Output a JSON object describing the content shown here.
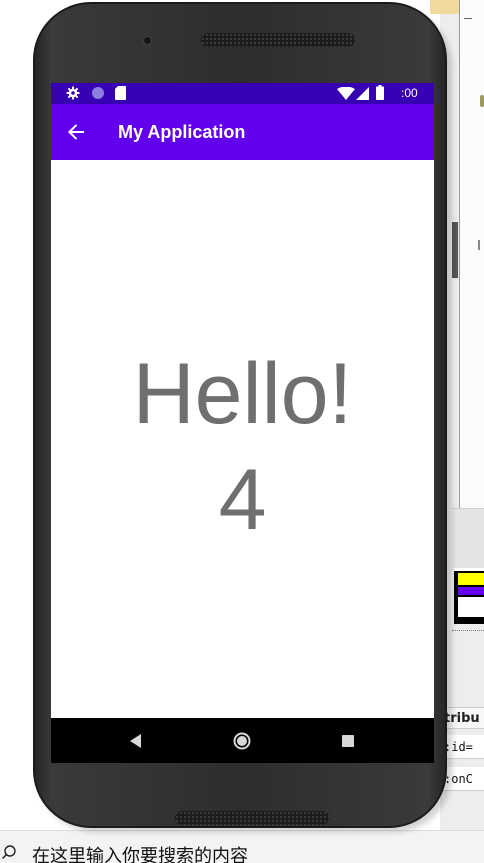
{
  "emulator": {
    "status_bar": {
      "time": ":00",
      "icons": [
        "gear-icon",
        "circle-icon",
        "sdcard-icon",
        "wifi-icon",
        "signal-icon",
        "battery-icon"
      ]
    },
    "app_bar": {
      "title": "My Application",
      "navigation_icon": "back-arrow-icon"
    },
    "content": {
      "greeting": "Hello!",
      "count": "4"
    },
    "nav_bar": {
      "buttons": [
        "nav-back-icon",
        "nav-home-icon",
        "nav-recents-icon"
      ]
    }
  },
  "ide": {
    "attributes_title": "tribu",
    "attribute_rows": [
      ":id=",
      ":onC"
    ]
  },
  "taskbar": {
    "search_placeholder": "在这里输入你要搜索的内容",
    "search_icon": "search-icon"
  },
  "colors": {
    "status_bar": "#3700b3",
    "app_bar": "#6200ee",
    "greeting_text": "#6f6f6f",
    "nav_bar": "#000000",
    "thumb_yellow": "#ffff00",
    "thumb_purple": "#6200ee"
  }
}
